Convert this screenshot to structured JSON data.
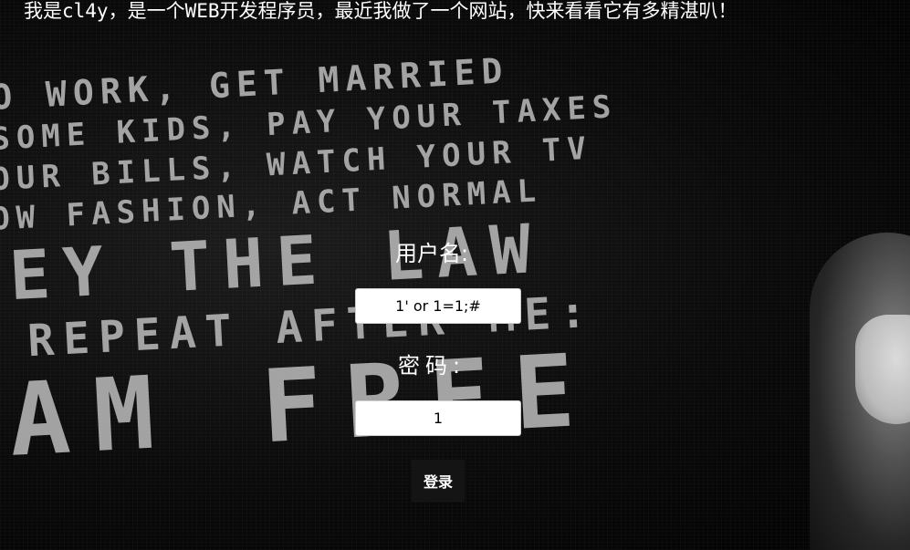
{
  "header": {
    "text": "我是cl4y，是一个WEB开发程序员，最近我做了一个网站，快来看看它有多精湛叭！"
  },
  "background": {
    "lines": [
      "O WORK, GET MARRIED",
      "SOME KIDS, PAY YOUR TAXES",
      "OUR BILLS, WATCH YOUR TV",
      "OW FASHION, ACT NORMAL",
      "EY THE LAW",
      "REPEAT AFTER ME:",
      "AM FREE"
    ]
  },
  "login": {
    "username_label": "用户名:",
    "username_value": "1' or 1=1;#",
    "password_label": "密码:",
    "password_value": "1",
    "submit_label": "登录"
  }
}
